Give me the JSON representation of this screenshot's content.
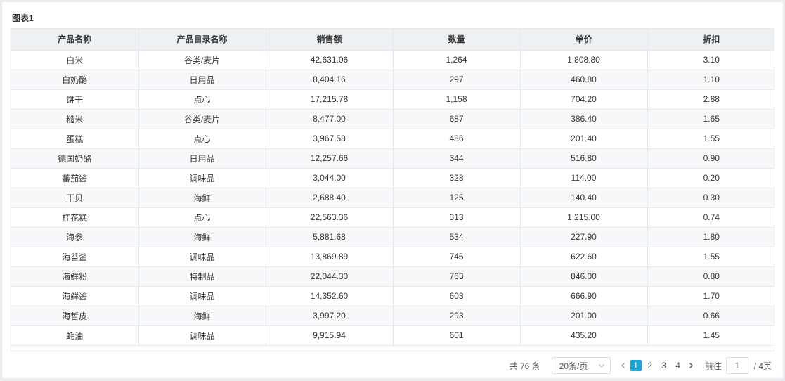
{
  "chart_title": "图表1",
  "table": {
    "columns": [
      "产品名称",
      "产品目录名称",
      "销售额",
      "数量",
      "单价",
      "折扣"
    ],
    "rows": [
      [
        "白米",
        "谷类/麦片",
        "42,631.06",
        "1,264",
        "1,808.80",
        "3.10"
      ],
      [
        "白奶酪",
        "日用品",
        "8,404.16",
        "297",
        "460.80",
        "1.10"
      ],
      [
        "饼干",
        "点心",
        "17,215.78",
        "1,158",
        "704.20",
        "2.88"
      ],
      [
        "糙米",
        "谷类/麦片",
        "8,477.00",
        "687",
        "386.40",
        "1.65"
      ],
      [
        "蛋糕",
        "点心",
        "3,967.58",
        "486",
        "201.40",
        "1.55"
      ],
      [
        "德国奶酪",
        "日用品",
        "12,257.66",
        "344",
        "516.80",
        "0.90"
      ],
      [
        "蕃茄酱",
        "调味品",
        "3,044.00",
        "328",
        "114.00",
        "0.20"
      ],
      [
        "干贝",
        "海鲜",
        "2,688.40",
        "125",
        "140.40",
        "0.30"
      ],
      [
        "桂花糕",
        "点心",
        "22,563.36",
        "313",
        "1,215.00",
        "0.74"
      ],
      [
        "海参",
        "海鲜",
        "5,881.68",
        "534",
        "227.90",
        "1.80"
      ],
      [
        "海苔酱",
        "调味品",
        "13,869.89",
        "745",
        "622.60",
        "1.55"
      ],
      [
        "海鲜粉",
        "特制品",
        "22,044.30",
        "763",
        "846.00",
        "0.80"
      ],
      [
        "海鲜酱",
        "调味品",
        "14,352.60",
        "603",
        "666.90",
        "1.70"
      ],
      [
        "海哲皮",
        "海鲜",
        "3,997.20",
        "293",
        "201.00",
        "0.66"
      ],
      [
        "蚝油",
        "调味品",
        "9,915.94",
        "601",
        "435.20",
        "1.45"
      ]
    ]
  },
  "pager": {
    "total_text": "共 76 条",
    "page_size_text": "20条/页",
    "prev_icon": "chevron-left-icon",
    "next_icon": "chevron-right-icon",
    "pages": [
      "1",
      "2",
      "3",
      "4"
    ],
    "active_page": "1",
    "goto_label": "前往",
    "goto_value": "1",
    "pages_total_text": "/ 4页"
  },
  "colors": {
    "accent": "#1fa4d8",
    "header_bg": "#eef1f4",
    "stripe_bg": "#f7f8fa"
  }
}
